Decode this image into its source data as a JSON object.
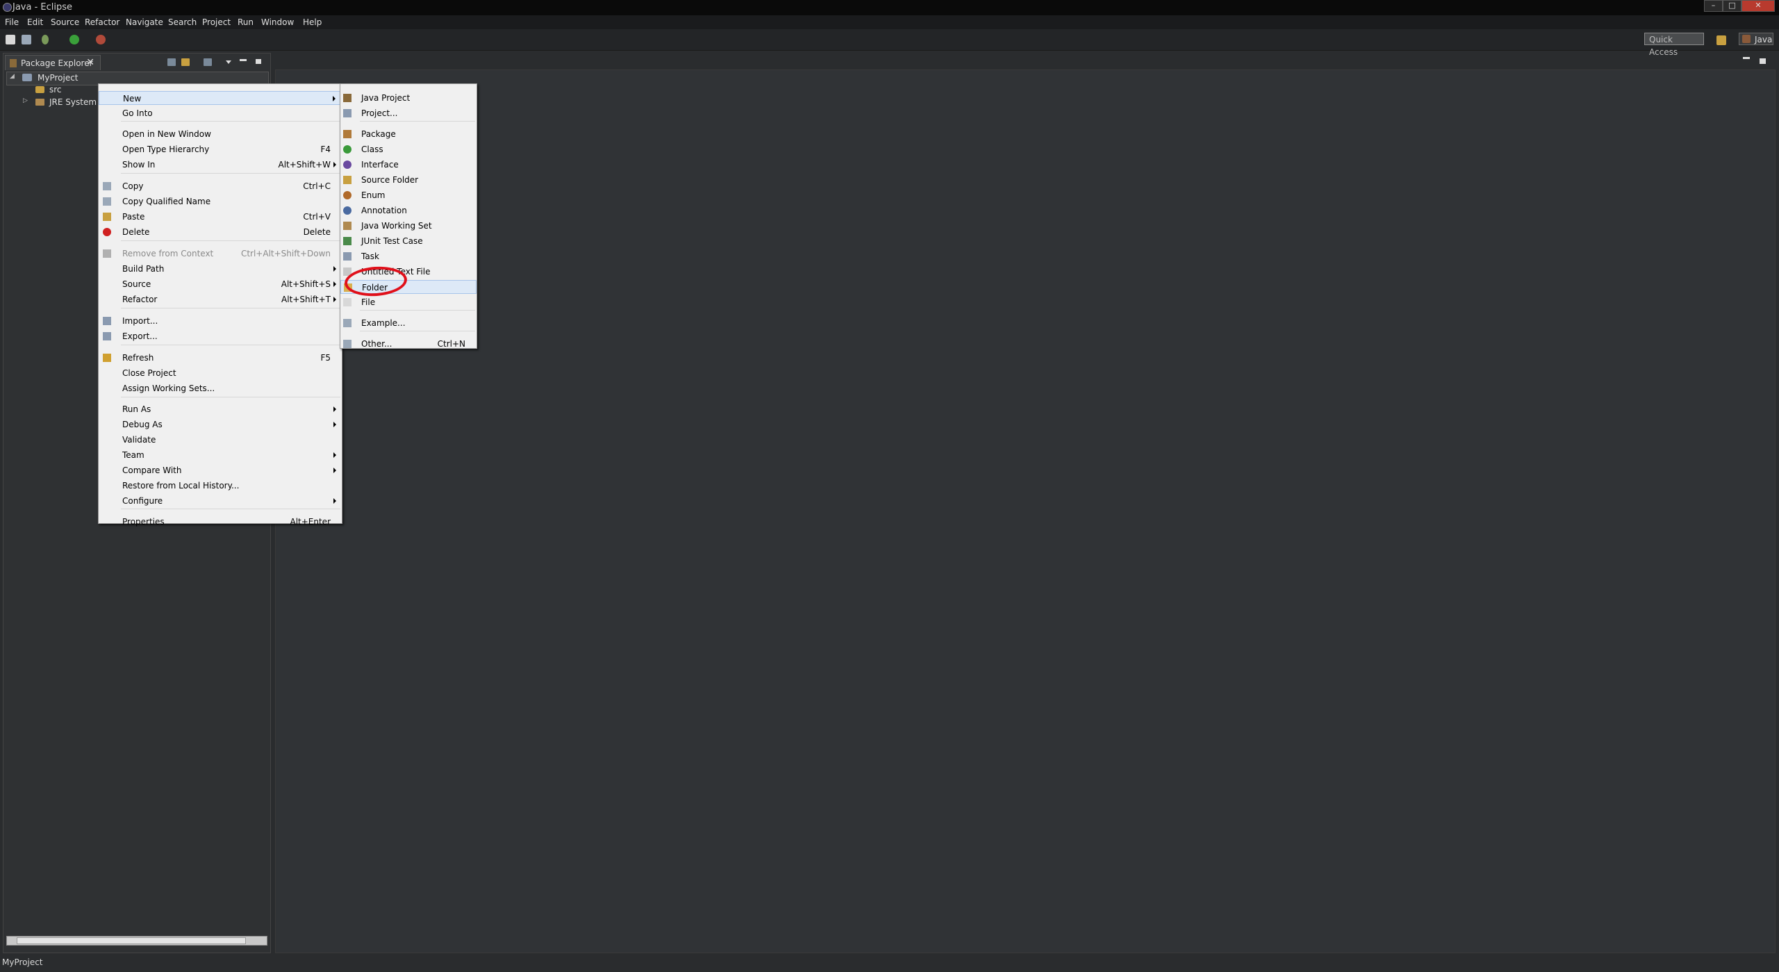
{
  "window": {
    "title": "Java - Eclipse",
    "minimize": "–",
    "maximize": "□",
    "close": "✕"
  },
  "menubar": [
    "File",
    "Edit",
    "Source",
    "Refactor",
    "Navigate",
    "Search",
    "Project",
    "Run",
    "Window",
    "Help"
  ],
  "toolbar": {
    "quick_access_placeholder": "Quick Access",
    "perspective_label": "Java"
  },
  "package_explorer": {
    "tab_label": "Package Explorer",
    "close_glyph": "✕",
    "tree": [
      {
        "label": "MyProject",
        "expanded": true,
        "selected": true
      },
      {
        "label": "src"
      },
      {
        "label": "JRE System Lib"
      }
    ],
    "expand_glyph_open": "◢",
    "expand_glyph_closed": "▷"
  },
  "context_menu": {
    "items": [
      {
        "label": "New",
        "submenu": true,
        "highlighted": true
      },
      {
        "label": "Go Into"
      },
      {
        "label": "Open in New Window"
      },
      {
        "label": "Open Type Hierarchy",
        "accel": "F4"
      },
      {
        "label": "Show In",
        "accel": "Alt+Shift+W",
        "submenu": true
      },
      {
        "label": "Copy",
        "accel": "Ctrl+C",
        "icon": "copy-icon"
      },
      {
        "label": "Copy Qualified Name",
        "icon": "copy-qualified-icon"
      },
      {
        "label": "Paste",
        "accel": "Ctrl+V",
        "icon": "paste-icon"
      },
      {
        "label": "Delete",
        "accel": "Delete",
        "icon": "delete-icon"
      },
      {
        "label": "Remove from Context",
        "accel": "Ctrl+Alt+Shift+Down",
        "disabled": true,
        "icon": "remove-context-icon"
      },
      {
        "label": "Build Path",
        "submenu": true
      },
      {
        "label": "Source",
        "accel": "Alt+Shift+S",
        "submenu": true
      },
      {
        "label": "Refactor",
        "accel": "Alt+Shift+T",
        "submenu": true
      },
      {
        "label": "Import...",
        "icon": "import-icon"
      },
      {
        "label": "Export...",
        "icon": "export-icon"
      },
      {
        "label": "Refresh",
        "accel": "F5",
        "icon": "refresh-icon"
      },
      {
        "label": "Close Project"
      },
      {
        "label": "Assign Working Sets..."
      },
      {
        "label": "Run As",
        "submenu": true
      },
      {
        "label": "Debug As",
        "submenu": true
      },
      {
        "label": "Validate"
      },
      {
        "label": "Team",
        "submenu": true
      },
      {
        "label": "Compare With",
        "submenu": true
      },
      {
        "label": "Restore from Local History..."
      },
      {
        "label": "Configure",
        "submenu": true
      },
      {
        "label": "Properties",
        "accel": "Alt+Enter"
      }
    ]
  },
  "new_submenu": {
    "items": [
      {
        "label": "Java Project",
        "icon": "java-project-icon"
      },
      {
        "label": "Project...",
        "icon": "project-icon"
      },
      {
        "label": "Package",
        "icon": "package-icon"
      },
      {
        "label": "Class",
        "icon": "class-icon"
      },
      {
        "label": "Interface",
        "icon": "interface-icon"
      },
      {
        "label": "Source Folder",
        "icon": "source-folder-icon"
      },
      {
        "label": "Enum",
        "icon": "enum-icon"
      },
      {
        "label": "Annotation",
        "icon": "annotation-icon"
      },
      {
        "label": "Java Working Set",
        "icon": "working-set-icon"
      },
      {
        "label": "JUnit Test Case",
        "icon": "junit-icon"
      },
      {
        "label": "Task",
        "icon": "task-icon"
      },
      {
        "label": "Untitled Text File",
        "icon": "text-file-icon"
      },
      {
        "label": "Folder",
        "icon": "folder-icon",
        "highlighted": true
      },
      {
        "label": "File",
        "icon": "file-icon"
      },
      {
        "label": "Example...",
        "icon": "example-icon"
      },
      {
        "label": "Other...",
        "accel": "Ctrl+N",
        "icon": "other-icon"
      }
    ]
  },
  "annotation": {
    "color": "#e0101a",
    "target": "Folder"
  },
  "status_bar": {
    "text": "MyProject"
  }
}
